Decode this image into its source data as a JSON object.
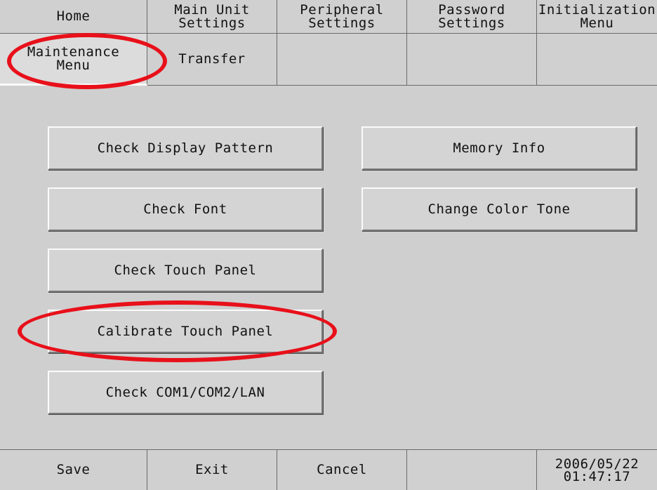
{
  "tabs_row1": [
    {
      "lines": [
        "Home"
      ]
    },
    {
      "lines": [
        "Main Unit",
        "Settings"
      ]
    },
    {
      "lines": [
        "Peripheral",
        "Settings"
      ]
    },
    {
      "lines": [
        "Password",
        "Settings"
      ]
    },
    {
      "lines": [
        "Initialization",
        "Menu"
      ]
    }
  ],
  "tabs_row2": [
    {
      "lines": [
        "Maintenance",
        "Menu"
      ],
      "active": true
    },
    {
      "lines": [
        "Transfer"
      ]
    },
    {
      "lines": [
        ""
      ]
    },
    {
      "lines": [
        ""
      ]
    },
    {
      "lines": [
        ""
      ]
    }
  ],
  "left_buttons": [
    "Check Display Pattern",
    "Check Font",
    "Check Touch Panel",
    "Calibrate Touch Panel",
    "Check COM1/COM2/LAN"
  ],
  "right_buttons": [
    "Memory Info",
    "Change Color Tone"
  ],
  "bottom_bar": {
    "save": "Save",
    "exit": "Exit",
    "cancel": "Cancel",
    "blank": "",
    "date": "2006/05/22",
    "time": "01:47:17"
  },
  "annotation_color": "#e8101a"
}
